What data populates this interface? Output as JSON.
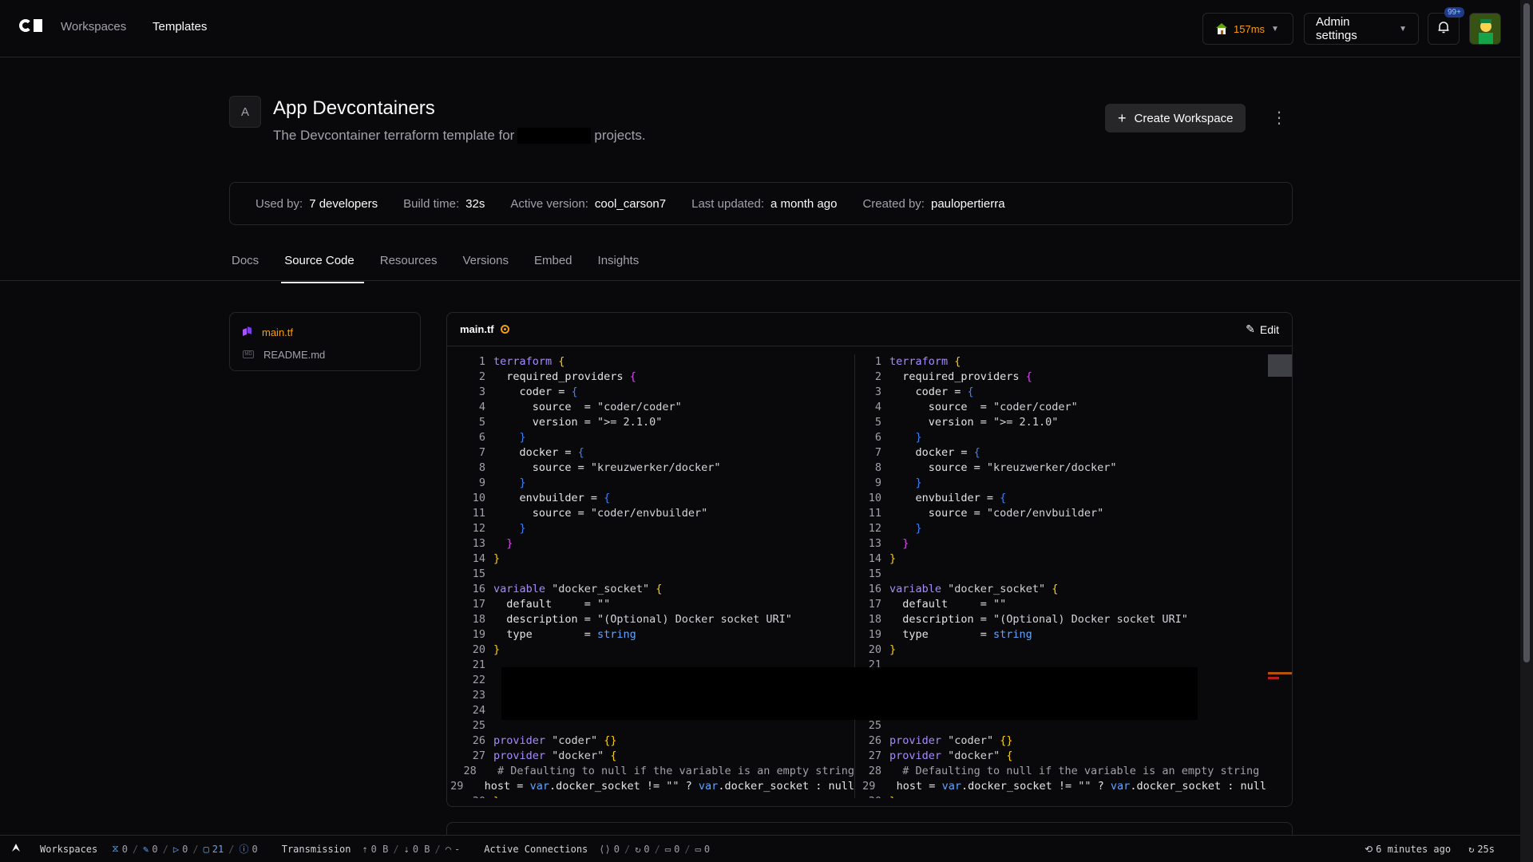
{
  "nav": {
    "workspaces": "Workspaces",
    "templates": "Templates",
    "latency": "157ms",
    "admin_settings": "Admin settings",
    "notifications_badge": "99+"
  },
  "template": {
    "avatar_letter": "A",
    "title": "App Devcontainers",
    "desc_before": "The Devcontainer terraform template for",
    "desc_after": "projects.",
    "create_button": "Create Workspace"
  },
  "stats": {
    "used_by_label": "Used by:",
    "used_by_value": "7 developers",
    "build_time_label": "Build time:",
    "build_time_value": "32s",
    "active_version_label": "Active version:",
    "active_version_value": "cool_carson7",
    "last_updated_label": "Last updated:",
    "last_updated_value": "a month ago",
    "created_by_label": "Created by:",
    "created_by_value": "paulopertierra"
  },
  "tabs": [
    "Docs",
    "Source Code",
    "Resources",
    "Versions",
    "Embed",
    "Insights"
  ],
  "active_tab": "Source Code",
  "files": [
    "main.tf",
    "README.md"
  ],
  "editor": {
    "filename": "main.tf",
    "edit_label": "Edit",
    "lines": [
      "terraform {",
      "  required_providers {",
      "    coder = {",
      "      source  = \"coder/coder\"",
      "      version = \">= 2.1.0\"",
      "    }",
      "    docker = {",
      "      source = \"kreuzwerker/docker\"",
      "    }",
      "    envbuilder = {",
      "      source = \"coder/envbuilder\"",
      "    }",
      "  }",
      "}",
      "",
      "variable \"docker_socket\" {",
      "  default     = \"\"",
      "  description = \"(Optional) Docker socket URI\"",
      "  type        = string",
      "}",
      "",
      "",
      "",
      "",
      "",
      "provider \"coder\" {}",
      "provider \"docker\" {",
      "  # Defaulting to null if the variable is an empty string",
      "  host = var.docker_socket != \"\" ? var.docker_socket : null",
      "}"
    ]
  },
  "statusbar": {
    "workspaces_label": "Workspaces",
    "ws_counts": [
      "0",
      "0",
      "0",
      "21",
      "0"
    ],
    "transmission_label": "Transmission",
    "tx_values": [
      "0 B",
      "0 B",
      "-"
    ],
    "connections_label": "Active Connections",
    "conn_counts": [
      "0",
      "0",
      "0",
      "0"
    ],
    "last_update": "6 minutes ago",
    "refresh": "25s"
  }
}
